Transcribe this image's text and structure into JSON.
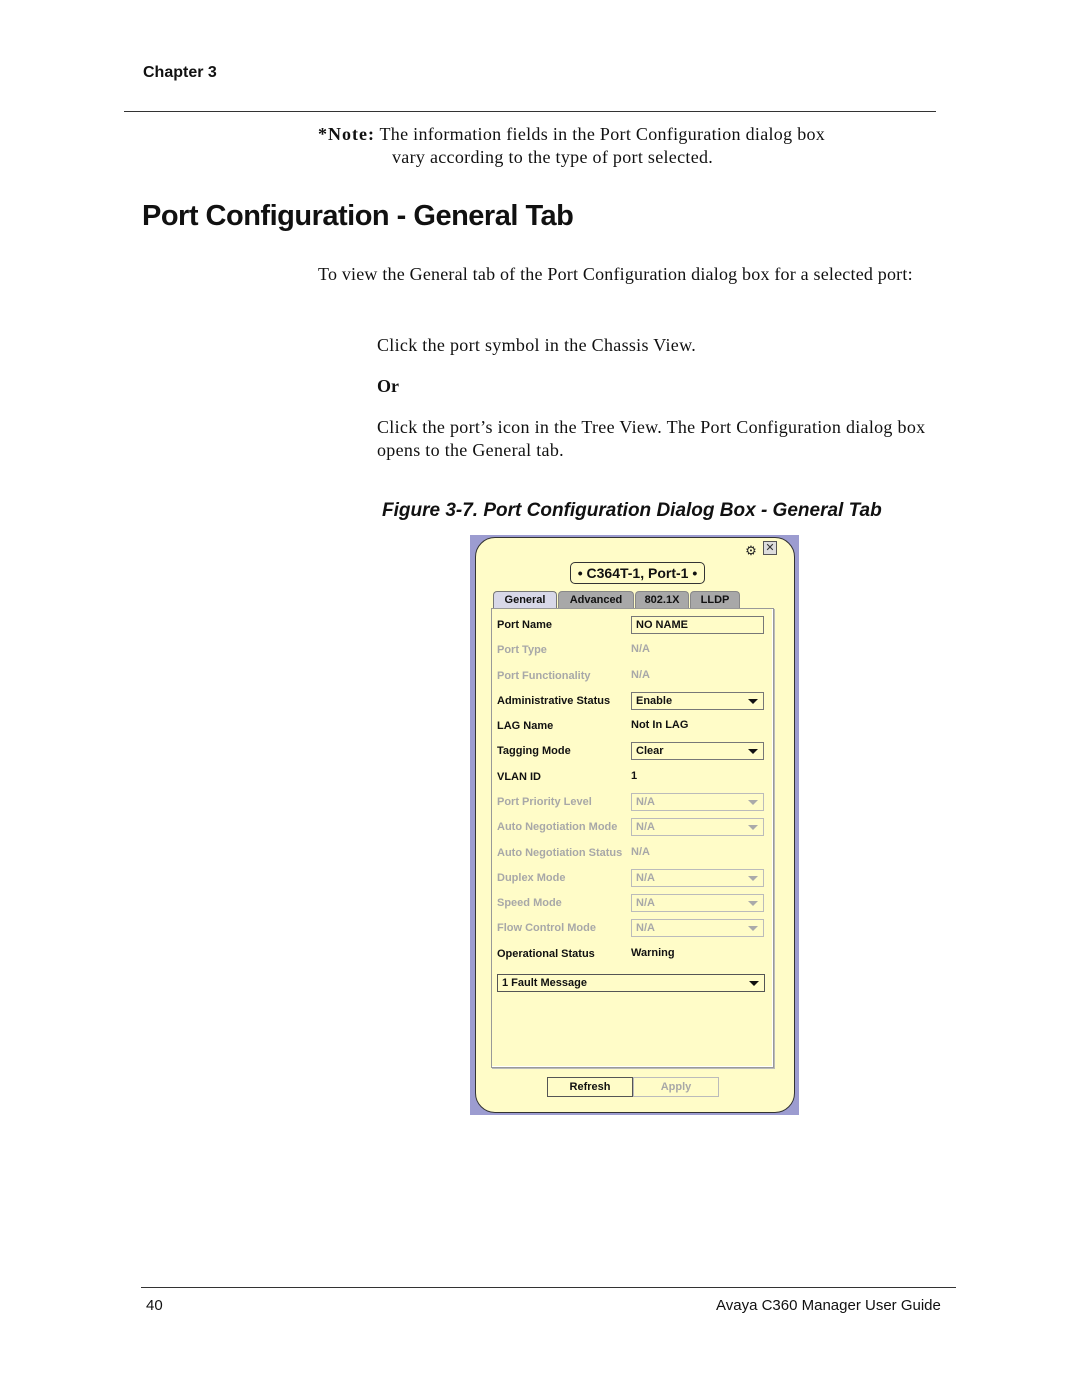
{
  "header": {
    "chapter": "Chapter 3"
  },
  "note": {
    "label": "*Note:",
    "line1": "The information fields in the Port Configuration dialog box",
    "line2": "vary according to the type of port selected."
  },
  "section": {
    "title": "Port Configuration - General Tab",
    "intro": "To view the General tab of the Port Configuration dialog box for a selected port:",
    "step1": "Click the port symbol in the Chassis View.",
    "or": "Or",
    "step2": "Click the port’s icon in the Tree View. The Port Configuration dialog box opens to the General tab.",
    "figure_caption": "Figure 3-7.  Port Configuration Dialog Box - General Tab"
  },
  "dialog": {
    "title": "• C364T-1, Port-1 •",
    "icons": {
      "help": "help-icon",
      "close": "close-icon"
    },
    "tabs": [
      {
        "label": "General",
        "active": true
      },
      {
        "label": "Advanced",
        "active": false
      },
      {
        "label": "802.1X",
        "active": false
      },
      {
        "label": "LLDP",
        "active": false
      }
    ],
    "fields": [
      {
        "label": "Port Name",
        "value": "NO NAME",
        "type": "text",
        "enabled": true
      },
      {
        "label": "Port Type",
        "value": "N/A",
        "type": "static",
        "enabled": false
      },
      {
        "label": "Port Functionality",
        "value": "N/A",
        "type": "static",
        "enabled": false
      },
      {
        "label": "Administrative Status",
        "value": "Enable",
        "type": "select",
        "enabled": true
      },
      {
        "label": "LAG Name",
        "value": "Not In LAG",
        "type": "static",
        "enabled": true
      },
      {
        "label": "Tagging Mode",
        "value": "Clear",
        "type": "select",
        "enabled": true
      },
      {
        "label": "VLAN ID",
        "value": "1",
        "type": "static",
        "enabled": true
      },
      {
        "label": "Port Priority Level",
        "value": "N/A",
        "type": "select",
        "enabled": false
      },
      {
        "label": "Auto Negotiation Mode",
        "value": "N/A",
        "type": "select",
        "enabled": false
      },
      {
        "label": "Auto Negotiation Status",
        "value": "N/A",
        "type": "static",
        "enabled": false
      },
      {
        "label": "Duplex Mode",
        "value": "N/A",
        "type": "select",
        "enabled": false
      },
      {
        "label": "Speed Mode",
        "value": "N/A",
        "type": "select",
        "enabled": false
      },
      {
        "label": "Flow Control Mode",
        "value": "N/A",
        "type": "select",
        "enabled": false
      },
      {
        "label": "Operational Status",
        "value": "Warning",
        "type": "static",
        "enabled": true
      }
    ],
    "fault_select": "1 Fault Message",
    "buttons": {
      "refresh": "Refresh",
      "apply": "Apply"
    }
  },
  "footer": {
    "page_number": "40",
    "guide_title": "Avaya C360 Manager User Guide"
  }
}
